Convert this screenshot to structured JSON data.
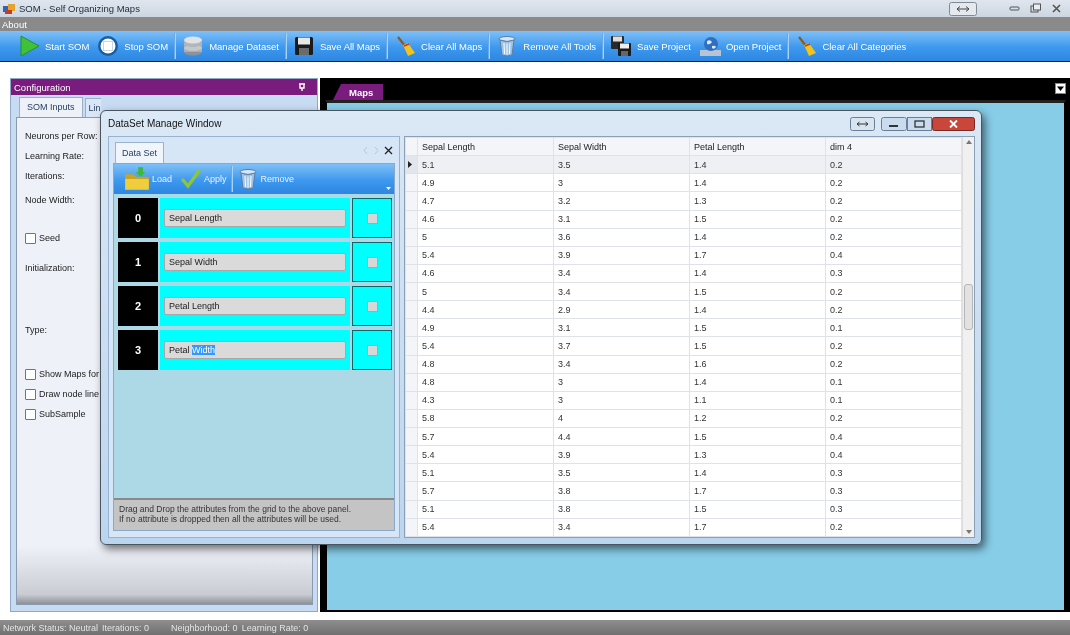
{
  "window": {
    "title": "SOM - Self Organizing Maps"
  },
  "menu": [
    {
      "label": "About"
    }
  ],
  "toolbar": [
    {
      "label": "Start SOM",
      "kind": "play"
    },
    {
      "label": "Stop SOM",
      "kind": "stop"
    },
    {
      "label": "Manage Dataset",
      "kind": "database"
    },
    {
      "label": "Save All Maps",
      "kind": "floppy"
    },
    {
      "label": "Clear All Maps",
      "kind": "broom"
    },
    {
      "label": "Remove All Tools",
      "kind": "trash"
    },
    {
      "label": "Save Project",
      "kind": "floppies"
    },
    {
      "label": "Open Project",
      "kind": "globe"
    },
    {
      "label": "Clear All Categories",
      "kind": "broom"
    }
  ],
  "configuration": {
    "title": "Configuration",
    "tabs": [
      {
        "label": "SOM Inputs",
        "selected": true
      },
      {
        "label": "Lin",
        "selected": false
      }
    ],
    "fields": [
      {
        "kind": "label",
        "text": "Neurons per Row:"
      },
      {
        "kind": "label",
        "text": "Learning Rate:"
      },
      {
        "kind": "label",
        "text": "Iterations:"
      },
      {
        "kind": "label",
        "text": "Node Width:"
      },
      {
        "kind": "checkbox",
        "text": "Seed",
        "checked": false
      },
      {
        "kind": "label",
        "text": "Initialization:"
      },
      {
        "kind": "label",
        "text": "Type:"
      },
      {
        "kind": "checkbox",
        "text": "Show Maps for",
        "checked": false
      },
      {
        "kind": "checkbox",
        "text": "Draw node line",
        "checked": false
      },
      {
        "kind": "checkbox",
        "text": "SubSample",
        "checked": false
      }
    ]
  },
  "maps": {
    "tabs": [
      {
        "label": "Maps",
        "selected": true
      }
    ]
  },
  "dialog": {
    "title": "DataSet Manage Window",
    "tabs": [
      {
        "label": "Data Set",
        "selected": true
      }
    ],
    "toolbar": [
      {
        "label": "Load",
        "kind": "folder"
      },
      {
        "label": "Apply",
        "kind": "check"
      },
      {
        "label": "Remove",
        "kind": "trash"
      }
    ],
    "attributes": [
      {
        "index": "0",
        "parts": [
          {
            "text": "Sepal Length",
            "highlighted": false
          }
        ],
        "checked": false
      },
      {
        "index": "1",
        "parts": [
          {
            "text": "Sepal Width",
            "highlighted": false
          }
        ],
        "checked": false
      },
      {
        "index": "2",
        "parts": [
          {
            "text": "Petal Length",
            "highlighted": false
          }
        ],
        "checked": false
      },
      {
        "index": "3",
        "parts": [
          {
            "text": "Petal ",
            "highlighted": false
          },
          {
            "text": "Width",
            "highlighted": true
          }
        ],
        "checked": false
      }
    ],
    "note": "Drag and Drop the attributes from the grid to the above panel.\nIf no attribute is dropped then all the attributes will be used.",
    "grid": {
      "columns": [
        "Sepal Length",
        "Sepal Width",
        "Petal Length",
        "dim 4"
      ],
      "rows": [
        {
          "selected": true,
          "cells": [
            "5.1",
            "3.5",
            "1.4",
            "0.2"
          ]
        },
        {
          "selected": false,
          "cells": [
            "4.9",
            "3",
            "1.4",
            "0.2"
          ]
        },
        {
          "selected": false,
          "cells": [
            "4.7",
            "3.2",
            "1.3",
            "0.2"
          ]
        },
        {
          "selected": false,
          "cells": [
            "4.6",
            "3.1",
            "1.5",
            "0.2"
          ]
        },
        {
          "selected": false,
          "cells": [
            "5",
            "3.6",
            "1.4",
            "0.2"
          ]
        },
        {
          "selected": false,
          "cells": [
            "5.4",
            "3.9",
            "1.7",
            "0.4"
          ]
        },
        {
          "selected": false,
          "cells": [
            "4.6",
            "3.4",
            "1.4",
            "0.3"
          ]
        },
        {
          "selected": false,
          "cells": [
            "5",
            "3.4",
            "1.5",
            "0.2"
          ]
        },
        {
          "selected": false,
          "cells": [
            "4.4",
            "2.9",
            "1.4",
            "0.2"
          ]
        },
        {
          "selected": false,
          "cells": [
            "4.9",
            "3.1",
            "1.5",
            "0.1"
          ]
        },
        {
          "selected": false,
          "cells": [
            "5.4",
            "3.7",
            "1.5",
            "0.2"
          ]
        },
        {
          "selected": false,
          "cells": [
            "4.8",
            "3.4",
            "1.6",
            "0.2"
          ]
        },
        {
          "selected": false,
          "cells": [
            "4.8",
            "3",
            "1.4",
            "0.1"
          ]
        },
        {
          "selected": false,
          "cells": [
            "4.3",
            "3",
            "1.1",
            "0.1"
          ]
        },
        {
          "selected": false,
          "cells": [
            "5.8",
            "4",
            "1.2",
            "0.2"
          ]
        },
        {
          "selected": false,
          "cells": [
            "5.7",
            "4.4",
            "1.5",
            "0.4"
          ]
        },
        {
          "selected": false,
          "cells": [
            "5.4",
            "3.9",
            "1.3",
            "0.4"
          ]
        },
        {
          "selected": false,
          "cells": [
            "5.1",
            "3.5",
            "1.4",
            "0.3"
          ]
        },
        {
          "selected": false,
          "cells": [
            "5.7",
            "3.8",
            "1.7",
            "0.3"
          ]
        },
        {
          "selected": false,
          "cells": [
            "5.1",
            "3.8",
            "1.5",
            "0.3"
          ]
        },
        {
          "selected": false,
          "cells": [
            "5.4",
            "3.4",
            "1.7",
            "0.2"
          ]
        }
      ]
    }
  },
  "status_bar": [
    {
      "text": "Network Status: Neutral"
    },
    {
      "text": "Iterations: 0"
    },
    {
      "text": "Neighborhood: 0"
    },
    {
      "text": "Learning Rate: 0"
    }
  ]
}
